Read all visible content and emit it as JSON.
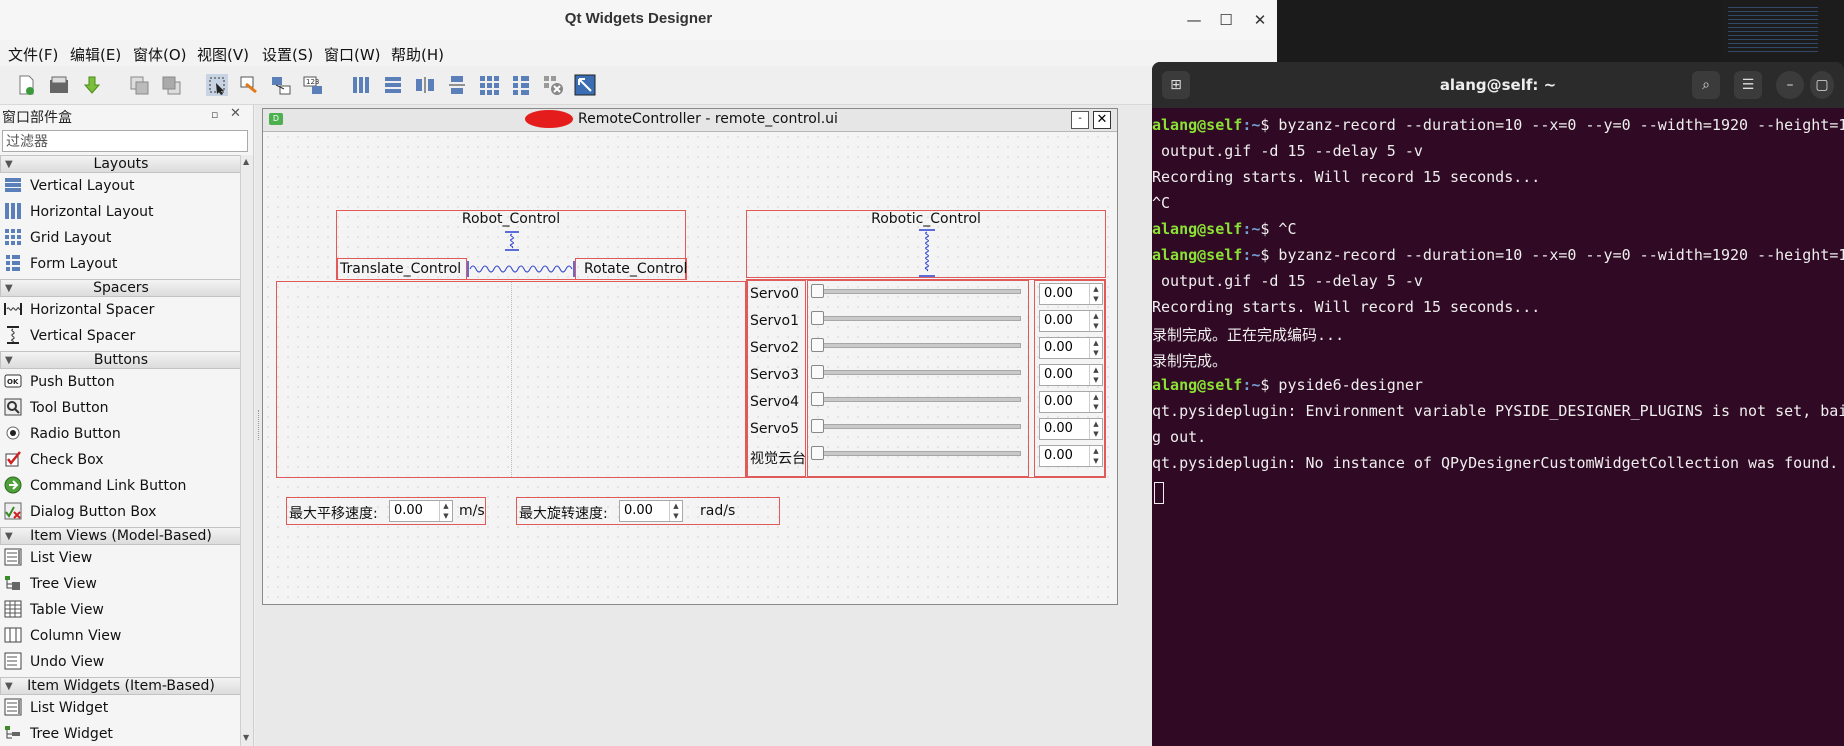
{
  "designer": {
    "title": "Qt Widgets Designer",
    "window_buttons": {
      "minimize": "—",
      "maximize": "☐",
      "close": "✕"
    },
    "menus": [
      "文件(F)",
      "编辑(E)",
      "窗体(O)",
      "视图(V)",
      "设置(S)",
      "窗口(W)",
      "帮助(H)"
    ]
  },
  "widget_box": {
    "title": "窗口部件盒",
    "filter_placeholder": "过滤器",
    "categories": {
      "layouts": "Layouts",
      "spacers": "Spacers",
      "buttons": "Buttons",
      "item_views": "Item Views (Model-Based)",
      "item_widgets": "Item Widgets (Item-Based)"
    },
    "layouts": [
      "Vertical Layout",
      "Horizontal Layout",
      "Grid Layout",
      "Form Layout"
    ],
    "spacers": [
      "Horizontal Spacer",
      "Vertical Spacer"
    ],
    "buttons": [
      "Push Button",
      "Tool Button",
      "Radio Button",
      "Check Box",
      "Command Link Button",
      "Dialog Button Box"
    ],
    "item_views": [
      "List View",
      "Tree View",
      "Table View",
      "Column View",
      "Undo View"
    ],
    "item_widgets": [
      "List Widget",
      "Tree Widget"
    ]
  },
  "form": {
    "title": "RemoteController - remote_control.ui",
    "robot_control": "Robot_Control",
    "translate_control": "Translate_Control",
    "rotate_control": "Rotate_Control",
    "robotic_control": "Robotic_Control",
    "servos": [
      {
        "label": "Servo0",
        "value": "0.00"
      },
      {
        "label": "Servo1",
        "value": "0.00"
      },
      {
        "label": "Servo2",
        "value": "0.00"
      },
      {
        "label": "Servo3",
        "value": "0.00"
      },
      {
        "label": "Servo4",
        "value": "0.00"
      },
      {
        "label": "Servo5",
        "value": "0.00"
      },
      {
        "label": "视觉云台",
        "value": "0.00"
      }
    ],
    "max_trans_label": "最大平移速度:",
    "max_trans_value": "0.00",
    "max_trans_unit": "m/s",
    "max_rot_label": "最大旋转速度:",
    "max_rot_value": "0.00",
    "max_rot_unit": "rad/s"
  },
  "terminal": {
    "title": "alang@self: ~",
    "prompt_user": "alang@self",
    "prompt_path": ":~",
    "lines": [
      {
        "prompt": true,
        "text": "$ byzanz-record --duration=10 --x=0 --y=0 --width=1920 --height=1"
      },
      {
        "prompt": false,
        "text": " output.gif -d 15 --delay 5 -v"
      },
      {
        "prompt": false,
        "text": "Recording starts. Will record 15 seconds..."
      },
      {
        "prompt": false,
        "text": "^C"
      },
      {
        "prompt": true,
        "text": "$ ^C"
      },
      {
        "prompt": true,
        "text": "$ byzanz-record --duration=10 --x=0 --y=0 --width=1920 --height=1"
      },
      {
        "prompt": false,
        "text": " output.gif -d 15 --delay 5 -v"
      },
      {
        "prompt": false,
        "text": "Recording starts. Will record 15 seconds..."
      },
      {
        "prompt": false,
        "text": "录制完成。正在完成编码..."
      },
      {
        "prompt": false,
        "text": "录制完成。"
      },
      {
        "prompt": true,
        "text": "$ pyside6-designer"
      },
      {
        "prompt": false,
        "text": "qt.pysideplugin: Environment variable PYSIDE_DESIGNER_PLUGINS is not set, bai"
      },
      {
        "prompt": false,
        "text": "g out."
      },
      {
        "prompt": false,
        "text": "qt.pysideplugin: No instance of QPyDesignerCustomWidgetCollection was found."
      }
    ]
  }
}
